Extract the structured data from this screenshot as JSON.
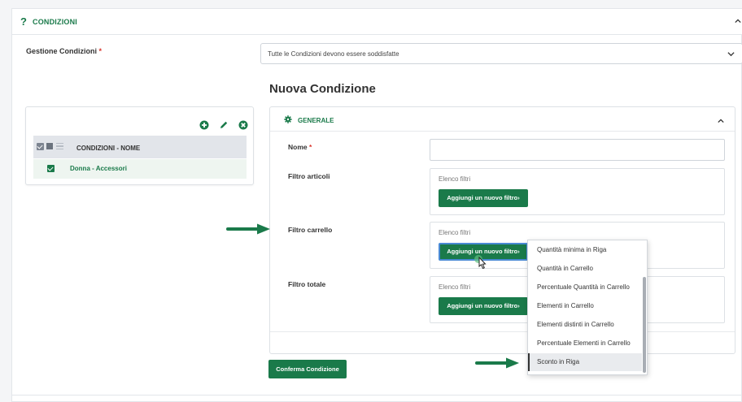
{
  "header": {
    "help_symbol": "?",
    "title": "CONDIZIONI"
  },
  "gestione": {
    "label": "Gestione Condizioni",
    "required_mark": "*",
    "selected_value": "Tutte le Condizioni devono essere soddisfatte"
  },
  "tree": {
    "header_label": "CONDIZIONI - NOME",
    "rows": [
      {
        "label": "Donna - Accessori"
      }
    ]
  },
  "form": {
    "title": "Nuova Condizione",
    "section_label": "GENERALE",
    "nome_label": "Nome",
    "nome_required": "*",
    "nome_value": "",
    "filters": [
      {
        "label": "Filtro articoli",
        "list_label": "Elenco filtri",
        "button": "Aggiungi un nuovo filtro"
      },
      {
        "label": "Filtro carrello",
        "list_label": "Elenco filtri",
        "button": "Aggiungi un nuovo filtro"
      },
      {
        "label": "Filtro totale",
        "list_label": "Elenco filtri",
        "button": "Aggiungi un nuovo filtro"
      }
    ],
    "confirm_button": "Conferma Condizione"
  },
  "dropdown": {
    "options": [
      "Quantità minima in Riga",
      "Quantità in Carrello",
      "Percentuale Quantità in Carrello",
      "Elementi in Carrello",
      "Elementi distinti in Carrello",
      "Percentuale Elementi in Carrello",
      "Sconto in Riga"
    ],
    "selected": "Sconto in Riga"
  },
  "colors": {
    "accent": "#1a7a4a",
    "required": "#d9342b",
    "focus": "#4a8ad4"
  },
  "icons": [
    "help-icon",
    "chevron-up-icon",
    "chevron-down-icon",
    "add-icon",
    "edit-icon",
    "delete-icon",
    "gear-icon",
    "cursor-icon",
    "arrow-right-icon"
  ]
}
